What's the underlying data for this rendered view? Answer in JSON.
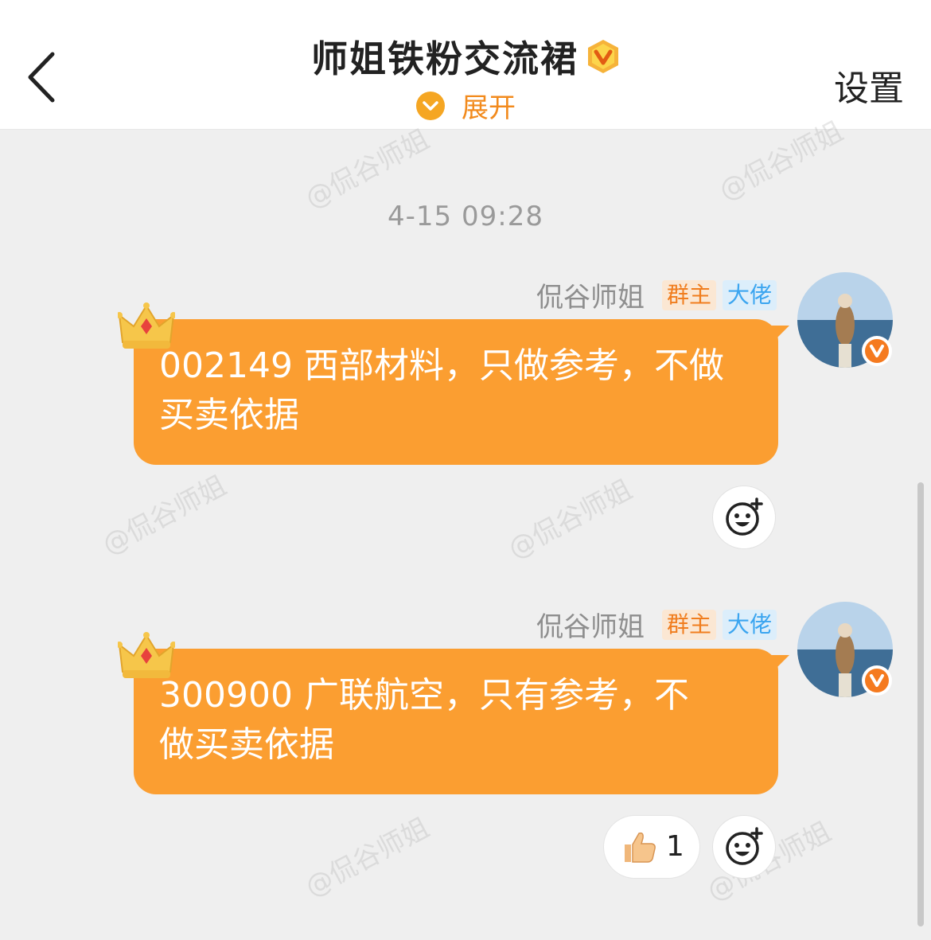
{
  "header": {
    "title": "师姐铁粉交流裙",
    "expand_label": "展开",
    "settings_label": "设置"
  },
  "chat": {
    "timestamp": "4-15 09:28",
    "messages": [
      {
        "sender": "侃谷师姐",
        "tags": [
          "群主",
          "大佬"
        ],
        "text_line1": "002149 西部材料，只做参考，不做",
        "text_line2": "买卖依据"
      },
      {
        "sender": "侃谷师姐",
        "tags": [
          "群主",
          "大佬"
        ],
        "text_line1": "300900 广联航空，只有参考，不",
        "text_line2": "做买卖依据",
        "reaction": {
          "icon": "thumbs-up",
          "count": "1"
        }
      }
    ]
  },
  "watermark": "@侃谷师姐",
  "colors": {
    "bubble": "#fb9e31",
    "accent": "#f28a1c",
    "tag_owner": "#f07d1e",
    "tag_vip": "#3ba5f0"
  }
}
